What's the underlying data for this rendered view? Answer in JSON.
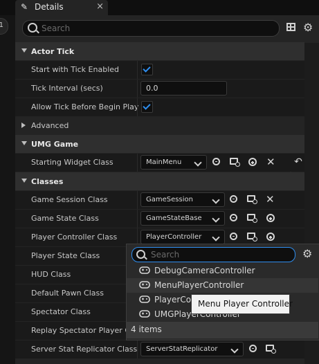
{
  "window": {
    "tab_title": "Details",
    "left_tab_badge": "1"
  },
  "search": {
    "placeholder": "Search"
  },
  "categories": {
    "actor_tick": "Actor Tick",
    "advanced": "Advanced",
    "umg_game": "UMG Game",
    "classes": "Classes"
  },
  "props": {
    "start_tick": {
      "label": "Start with Tick Enabled",
      "checked": true
    },
    "tick_interval": {
      "label": "Tick Interval (secs)",
      "value": "0.0"
    },
    "allow_tick": {
      "label": "Allow Tick Before Begin Play",
      "checked": true
    },
    "starting_widget": {
      "label": "Starting Widget Class",
      "value": "MainMenu"
    },
    "game_session": {
      "label": "Game Session Class",
      "value": "GameSession"
    },
    "game_state": {
      "label": "Game State Class",
      "value": "GameStateBase"
    },
    "player_controller": {
      "label": "Player Controller Class",
      "value": "PlayerController"
    },
    "player_state": {
      "label": "Player State Class"
    },
    "hud": {
      "label": "HUD Class"
    },
    "default_pawn": {
      "label": "Default Pawn Class"
    },
    "spectator": {
      "label": "Spectator Class"
    },
    "replay_spectator": {
      "label": "Replay Spectator Player Co"
    },
    "server_stat": {
      "label": "Server Stat Replicator Class",
      "value": "ServerStatReplicator"
    }
  },
  "popup": {
    "search_placeholder": "Search",
    "items": [
      "DebugCameraController",
      "MenuPlayerController",
      "PlayerCo",
      "UMGPlayerController"
    ],
    "tooltip": "Menu Player Controller",
    "count": "4 items"
  },
  "colors": {
    "accent": "#2e8ef0",
    "panel": "#242424",
    "row": "#1a1a1a",
    "category": "#2f2f2f"
  }
}
